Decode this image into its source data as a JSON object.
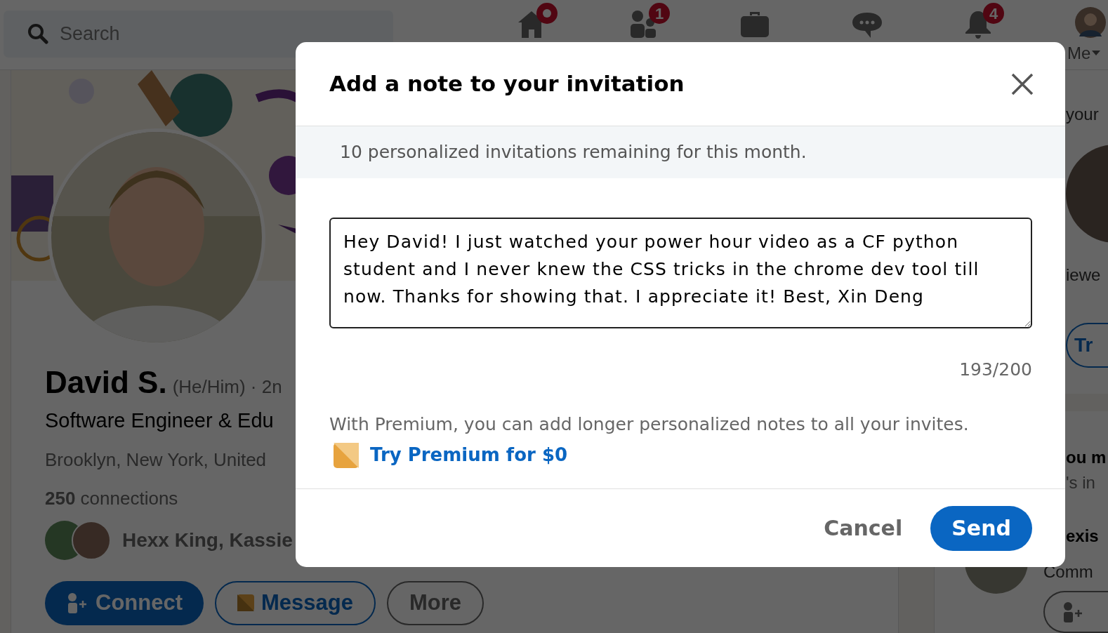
{
  "nav": {
    "search": {
      "placeholder": "Search"
    },
    "items": [
      {
        "kind": "home",
        "badge_dot": true
      },
      {
        "kind": "network",
        "badge": "1"
      },
      {
        "kind": "jobs"
      },
      {
        "kind": "messaging"
      },
      {
        "kind": "notifications",
        "badge": "4"
      }
    ],
    "me_label": "Me"
  },
  "profile": {
    "name": "David S.",
    "pronouns": "(He/Him) · 2n",
    "headline": "Software Engineer & Edu",
    "location": "Brooklyn, New York, United",
    "connections_count": "250",
    "connections_label": "connections",
    "mutual": "Hexx King, Kassie",
    "actions": [
      {
        "label": "Connect",
        "kind": "primary"
      },
      {
        "label": "Message",
        "kind": "premium"
      },
      {
        "label": "More",
        "kind": "outline"
      }
    ]
  },
  "right_rail": {
    "top_card": {
      "line_1": "your",
      "line_2": "iewe",
      "button": "Tr"
    },
    "bottom_card": {
      "title": "ou m",
      "subtitle": "'s in",
      "person_name": "exis",
      "person_headline": "Comm"
    }
  },
  "modal": {
    "title": "Add a note to your invitation",
    "notice": "10 personalized invitations remaining for this month.",
    "message": "Hey David! I just watched your power hour video as a CF python student and I never knew the CSS tricks in the chrome dev tool till now. Thanks for showing that. I appreciate it! Best, Xin Deng",
    "counter": "193/200",
    "premium_text": "With Premium, you can add longer personalized notes to all your invites.",
    "premium_link": "Try Premium for $0",
    "buttons": [
      {
        "label": "Cancel",
        "kind": "secondary"
      },
      {
        "label": "Send",
        "kind": "primary"
      }
    ]
  }
}
